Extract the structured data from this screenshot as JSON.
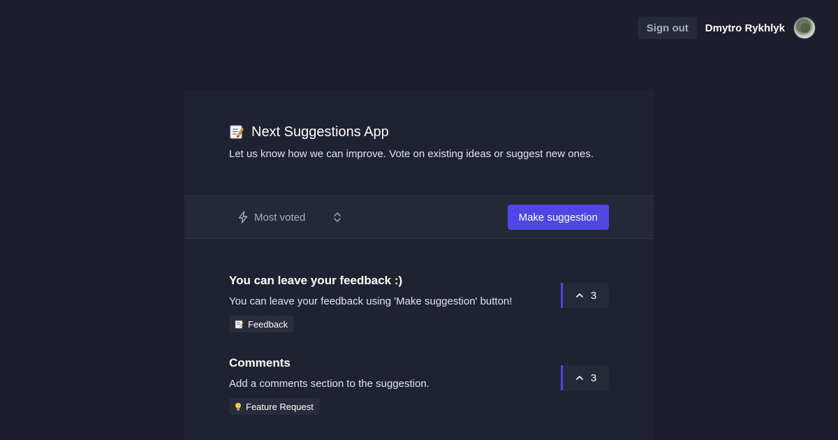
{
  "topbar": {
    "signout_label": "Sign out",
    "username": "Dmytro Rykhlyk",
    "avatar": "user-avatar-photo"
  },
  "header": {
    "title_icon": "memo-icon",
    "title": "Next Suggestions App",
    "description": "Let us know how we can improve. Vote on existing ideas or suggest new ones."
  },
  "toolbar": {
    "sort_icon": "bolt-icon",
    "sort_label": "Most voted",
    "sort_chevron_icon": "chevron-up-down-icon",
    "make_suggestion_label": "Make suggestion"
  },
  "colors": {
    "background": "#1c1f2b",
    "panel": "#1f2230",
    "accent": "#4f46e5"
  },
  "suggestions": [
    {
      "title": "You can leave your feedback :)",
      "description": "You can leave your feedback using 'Make suggestion' button!",
      "tag_icon": "memo-icon",
      "tag": "Feedback",
      "votes": "3"
    },
    {
      "title": "Comments",
      "description": "Add a comments section to the suggestion.",
      "tag_icon": "lightbulb-icon",
      "tag": "Feature Request",
      "votes": "3"
    }
  ]
}
